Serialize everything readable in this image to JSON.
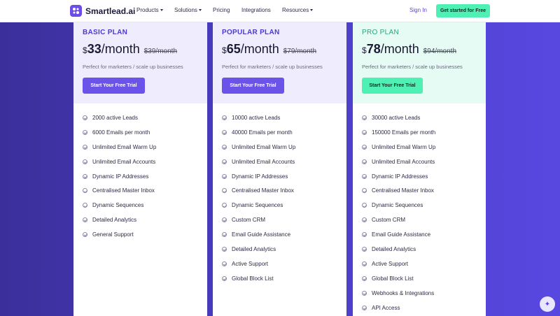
{
  "nav": {
    "logo_text": "Smartlead.ai",
    "links": [
      {
        "label": "Products",
        "dropdown": true
      },
      {
        "label": "Solutions",
        "dropdown": true
      },
      {
        "label": "Pricing",
        "dropdown": false
      },
      {
        "label": "Integrations",
        "dropdown": false
      },
      {
        "label": "Resources",
        "dropdown": true
      }
    ],
    "signin": "Sign In",
    "cta": "Get started for Free"
  },
  "plans": [
    {
      "name": "BASIC PLAN",
      "currency": "$",
      "price": "33",
      "period": "/month",
      "old_price": "$39/month",
      "description": "Perfect for marketers / scale up businesses",
      "button": "Start Your Free Trial",
      "features": [
        "2000 active Leads",
        "6000 Emails per month",
        "Unlimited Email Warm Up",
        "Unlimited Email Accounts",
        "Dynamic IP Addresses",
        "Centralised Master Inbox",
        "Dynamic Sequences",
        "Detailed Analytics",
        "General Support"
      ]
    },
    {
      "name": "POPULAR PLAN",
      "currency": "$",
      "price": "65",
      "period": "/month",
      "old_price": "$79/month",
      "description": "Perfect for marketers / scale up businesses",
      "button": "Start Your Free Trial",
      "features": [
        "10000 active Leads",
        "40000 Emails per month",
        "Unlimited Email Warm Up",
        "Unlimited Email Accounts",
        "Dynamic IP Addresses",
        "Centralised Master Inbox",
        "Dynamic Sequences",
        "Custom CRM",
        "Email Guide Assistance",
        "Detailed Analytics",
        "Active Support",
        "Global Block List"
      ]
    },
    {
      "name": "PRO PLAN",
      "currency": "$",
      "price": "78",
      "period": "/month",
      "old_price": "$94/month",
      "description": "Perfect for marketers / scale up businesses",
      "button": "Start Your Free Trial",
      "features": [
        "30000 active Leads",
        "150000 Emails per month",
        "Unlimited Email Warm Up",
        "Unlimited Email Accounts",
        "Dynamic IP Addresses",
        "Centralised Master Inbox",
        "Dynamic Sequences",
        "Custom CRM",
        "Email Guide Assistance",
        "Detailed Analytics",
        "Active Support",
        "Global Block List",
        "Webhooks & Integrations",
        "API Access"
      ]
    }
  ],
  "colors": {
    "accent": "#6b52e8",
    "pro_accent": "#4ff0b4",
    "basic_head": "#efedfd",
    "popular_head": "#efedfd",
    "pro_head": "#e6fbf3"
  },
  "icons": {
    "check": "check-circle-icon",
    "chat": "chat-bubble-icon"
  }
}
